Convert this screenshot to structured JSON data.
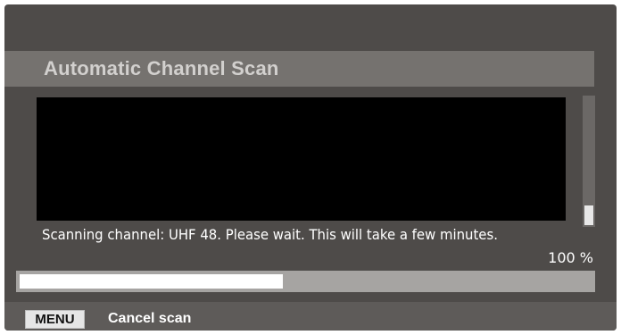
{
  "dialog": {
    "title": "Automatic Channel Scan"
  },
  "scan": {
    "status": "Scanning channel: UHF 48. Please wait. This will take a few minutes.",
    "percent_label": "100 %",
    "progress_fraction": 0.46
  },
  "footer": {
    "menu_key": "MENU",
    "cancel_label": "Cancel scan"
  },
  "colors": {
    "background": "#4e4b49",
    "title_bar": "#75726f",
    "progress_track": "#a6a4a2",
    "progress_fill": "#ffffff"
  }
}
